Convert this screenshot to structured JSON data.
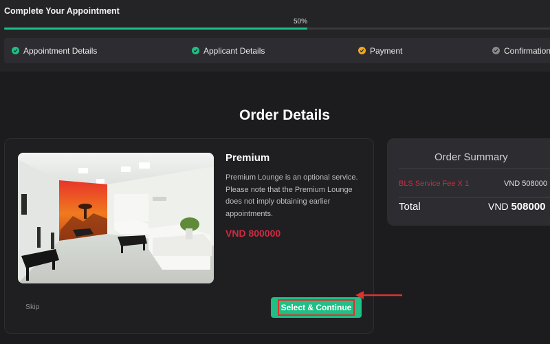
{
  "header": {
    "title": "Complete Your Appointment",
    "progress_label": "50%",
    "progress_fraction": 0.5
  },
  "steps": [
    {
      "label": "Appointment Details",
      "status": "complete",
      "icon": "check-circle-icon",
      "color": "#1fbf85"
    },
    {
      "label": "Applicant Details",
      "status": "complete",
      "icon": "check-circle-icon",
      "color": "#1fbf85"
    },
    {
      "label": "Payment",
      "status": "current",
      "icon": "check-circle-icon",
      "color": "#f0a81c"
    },
    {
      "label": "Confirmation",
      "status": "pending",
      "icon": "check-circle-icon",
      "color": "#8a8a8a"
    }
  ],
  "main": {
    "section_title": "Order Details"
  },
  "product": {
    "name": "Premium",
    "description": "Premium Lounge is an optional service. Please note that the Premium Lounge does not imply obtaining earlier appointments.",
    "price": "VND 800000",
    "skip_label": "Skip",
    "select_label": "Select & Continue"
  },
  "summary": {
    "title": "Order Summary",
    "fee_label": "BLS Service Fee X 1",
    "fee_value": "VND 508000",
    "total_label": "Total",
    "total_currency": "VND",
    "total_amount": "508000"
  },
  "colors": {
    "accent_green": "#1fbf85",
    "price_red": "#d6283f",
    "highlight_red": "#e0312e",
    "pending_orange": "#f0a81c"
  }
}
